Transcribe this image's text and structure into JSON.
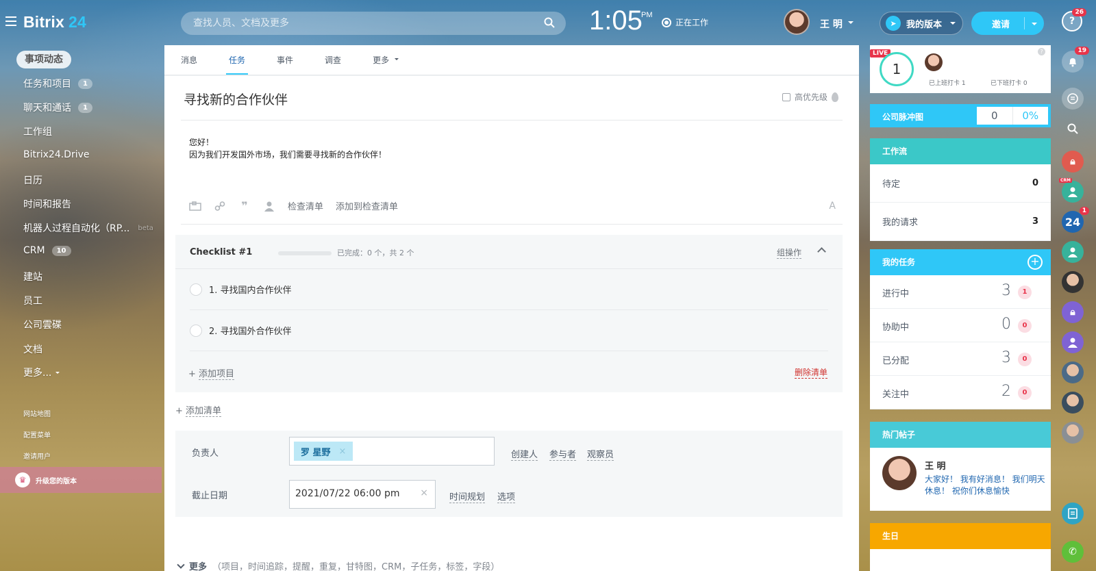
{
  "topbar": {
    "logo_text": "Bitrix",
    "logo_number": "24",
    "search_placeholder": "查找人员、文档及更多",
    "clock_time": "1:05",
    "clock_ampm": "PM",
    "work_status": "正在工作",
    "user_name": "王 明",
    "my_plan_label": "我的版本",
    "invite_label": "邀请",
    "help_badge": "26"
  },
  "leftnav": {
    "active_item": "事项动态",
    "items": [
      {
        "label": "任务和项目",
        "counter": "1"
      },
      {
        "label": "聊天和通话",
        "counter": "1"
      },
      {
        "label": "工作组"
      },
      {
        "label": "Bitrix24.Drive"
      },
      {
        "label": "日历"
      },
      {
        "label": "时间和报告"
      },
      {
        "label": "机器人过程自动化（RP...",
        "tag": "beta"
      },
      {
        "label": "CRM",
        "counter": "10"
      },
      {
        "label": "建站"
      },
      {
        "label": "员工"
      },
      {
        "label": "公司雲碟"
      },
      {
        "label": "文档"
      },
      {
        "label": "更多..."
      }
    ],
    "small_links": [
      "网站地图",
      "配置菜单",
      "邀请用户"
    ],
    "upgrade_label": "升级您的版本"
  },
  "main": {
    "tabs": [
      {
        "label": "消息"
      },
      {
        "label": "任务",
        "active": true
      },
      {
        "label": "事件"
      },
      {
        "label": "调查"
      },
      {
        "label": "更多"
      }
    ],
    "task_title": "寻找新的合作伙伴",
    "priority_label": "高优先级",
    "description_line1": "您好！",
    "description_line2": "因为我们开发国外市场，我们需要寻找新的合作伙伴！",
    "toolbar": {
      "checklist_label": "检查清单",
      "add_to_checklist_label": "添加到检查清单",
      "font_icon_glyph": "A"
    },
    "checklist": {
      "title": "Checklist #1",
      "progress": 0,
      "status": "已完成：0 个，共 2 个",
      "group_action": "组操作",
      "items": [
        {
          "label": "1. 寻找国内合作伙伴"
        },
        {
          "label": "2. 寻找国外合作伙伴"
        }
      ],
      "add_item_prefix": "+",
      "add_item_label": "添加项目",
      "delete_label": "删除清单"
    },
    "add_checklist_prefix": "+",
    "add_checklist_label": "添加清单",
    "fields": {
      "responsible_label": "负责人",
      "responsible_value": "罗 星野",
      "creator_link": "创建人",
      "participants_link": "参与者",
      "observers_link": "观察员",
      "deadline_label": "截止日期",
      "deadline_value": "2021/07/22 06:00 pm",
      "time_planning_link": "时间规划",
      "options_link": "选项"
    },
    "more_label": "更多",
    "more_details": "（项目，时间追踪，提醒，重复，甘特图，CRM，子任务，标签，字段）"
  },
  "rightpanel": {
    "live_badge": "LIVE",
    "pulse_count": "1",
    "checked_in_label": "已上班打卡",
    "checked_in_count": "1",
    "checked_out_label": "已下班打卡",
    "checked_out_count": "0",
    "company_pulse_label": "公司脉冲图",
    "company_pulse_value": "0",
    "company_pulse_percent": "0%",
    "workflow_title": "工作流",
    "workflow_rows": [
      {
        "label": "待定",
        "value": "0"
      },
      {
        "label": "我的请求",
        "value": "3"
      }
    ],
    "my_tasks_title": "我的任务",
    "task_rows": [
      {
        "label": "进行中",
        "count": "3",
        "badge": "1"
      },
      {
        "label": "协助中",
        "count": "0",
        "badge": "0"
      },
      {
        "label": "已分配",
        "count": "3",
        "badge": "0"
      },
      {
        "label": "关注中",
        "count": "2",
        "badge": "0"
      }
    ],
    "hot_posts_title": "热门帖子",
    "hot_post_author": "王 明",
    "hot_post_text": "大家好！ 我有好消息！ 我们明天休息！ 祝你们休息愉快",
    "birthdays_title": "生日"
  },
  "rightcol": {
    "notifications_badge": "19",
    "bitrix_badge": "1",
    "bitrix_label": "24",
    "crm_tag": "CRM"
  },
  "colors": {
    "accent": "#2fc7f7",
    "link": "#2067b0",
    "danger": "#e8344a",
    "workflow": "#3bc8c8",
    "birthday": "#f7a700"
  }
}
